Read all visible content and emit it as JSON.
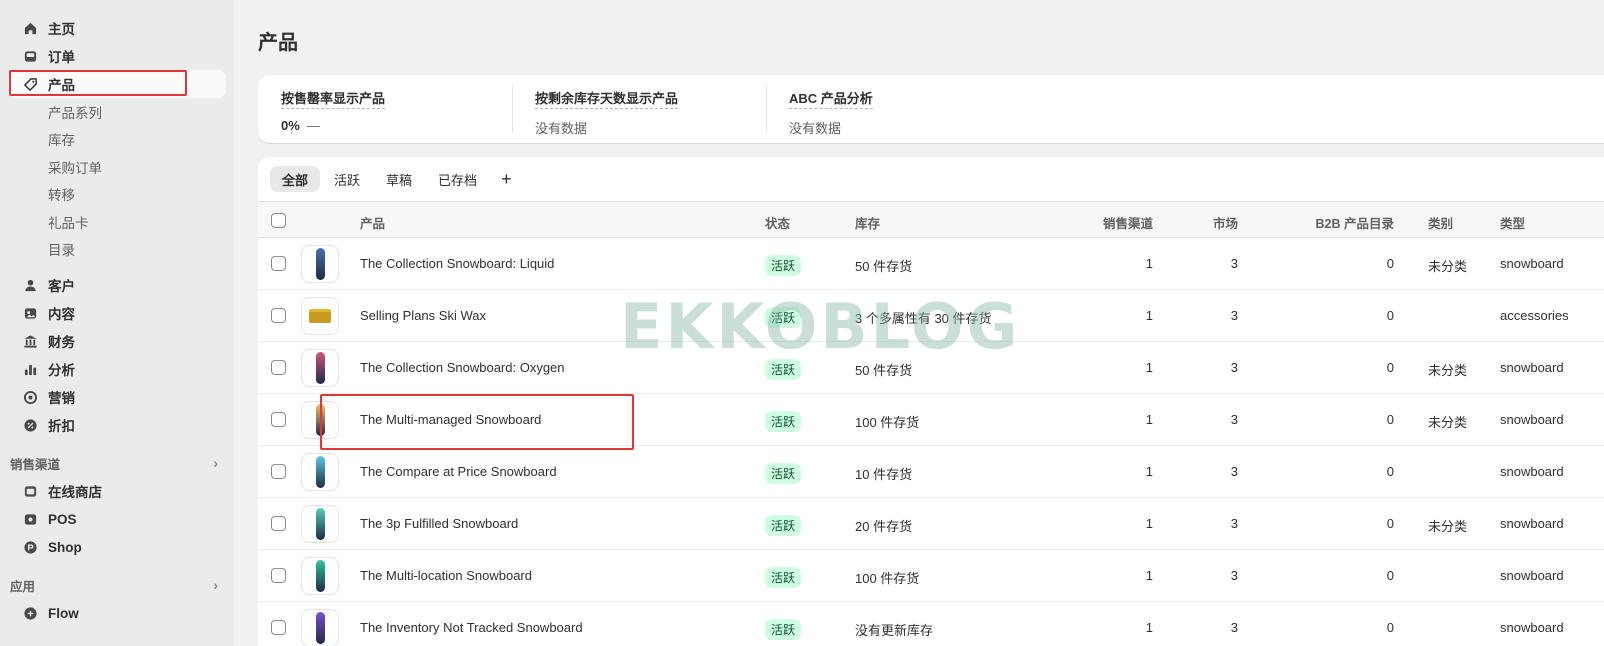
{
  "sidebar": {
    "items": [
      {
        "label": "主页",
        "icon": "home-icon"
      },
      {
        "label": "订单",
        "icon": "inbox-icon"
      },
      {
        "label": "产品",
        "icon": "tag-icon",
        "active": true
      }
    ],
    "product_sub": [
      "产品系列",
      "库存",
      "采购订单",
      "转移",
      "礼品卡",
      "目录"
    ],
    "items2": [
      {
        "label": "客户",
        "icon": "person-icon"
      },
      {
        "label": "内容",
        "icon": "content-icon"
      },
      {
        "label": "财务",
        "icon": "bank-icon"
      },
      {
        "label": "分析",
        "icon": "chart-icon"
      },
      {
        "label": "营销",
        "icon": "target-icon"
      },
      {
        "label": "折扣",
        "icon": "discount-icon"
      }
    ],
    "sales_channels_title": "销售渠道",
    "channels": [
      {
        "label": "在线商店",
        "icon": "store-icon"
      },
      {
        "label": "POS",
        "icon": "pos-icon"
      },
      {
        "label": "Shop",
        "icon": "shop-icon"
      }
    ],
    "apps_title": "应用",
    "apps": [
      {
        "label": "Flow",
        "icon": "flow-icon"
      }
    ]
  },
  "page": {
    "title": "产品"
  },
  "analytics": [
    {
      "title": "按售罄率显示产品",
      "value": "0%",
      "extra": "—"
    },
    {
      "title": "按剩余库存天数显示产品",
      "value": "没有数据",
      "extra": ""
    },
    {
      "title": "ABC 产品分析",
      "value": "没有数据",
      "extra": ""
    }
  ],
  "tabs": [
    "全部",
    "活跃",
    "草稿",
    "已存档"
  ],
  "tab_add": "+",
  "columns": {
    "product": "产品",
    "status": "状态",
    "inventory": "库存",
    "channels": "销售渠道",
    "markets": "市场",
    "b2b": "B2B 产品目录",
    "category": "类别",
    "type": "类型"
  },
  "rows": [
    {
      "name": "The Collection Snowboard: Liquid",
      "status": "活跃",
      "inventory": "50 件存货",
      "channels": "1",
      "markets": "3",
      "b2b": "0",
      "category": "未分类",
      "type": "snowboard",
      "thumb_color": "#4a6fa8"
    },
    {
      "name": "Selling Plans Ski Wax",
      "status": "活跃",
      "inventory": "3 个多属性有 30 件存货",
      "channels": "1",
      "markets": "3",
      "b2b": "0",
      "category": "",
      "type": "accessories",
      "thumb_color": "#c99a22"
    },
    {
      "name": "The Collection Snowboard: Oxygen",
      "status": "活跃",
      "inventory": "50 件存货",
      "channels": "1",
      "markets": "3",
      "b2b": "0",
      "category": "未分类",
      "type": "snowboard",
      "thumb_color": "#d0567a"
    },
    {
      "name": "The Multi-managed Snowboard",
      "status": "活跃",
      "inventory": "100 件存货",
      "channels": "1",
      "markets": "3",
      "b2b": "0",
      "category": "未分类",
      "type": "snowboard",
      "thumb_color": "#f2c26b"
    },
    {
      "name": "The Compare at Price Snowboard",
      "status": "活跃",
      "inventory": "10 件存货",
      "channels": "1",
      "markets": "3",
      "b2b": "0",
      "category": "",
      "type": "snowboard",
      "thumb_color": "#5cc8e0"
    },
    {
      "name": "The 3p Fulfilled Snowboard",
      "status": "活跃",
      "inventory": "20 件存货",
      "channels": "1",
      "markets": "3",
      "b2b": "0",
      "category": "未分类",
      "type": "snowboard",
      "thumb_color": "#4fd1b5"
    },
    {
      "name": "The Multi-location Snowboard",
      "status": "活跃",
      "inventory": "100 件存货",
      "channels": "1",
      "markets": "3",
      "b2b": "0",
      "category": "",
      "type": "snowboard",
      "thumb_color": "#2fc79a"
    },
    {
      "name": "The Inventory Not Tracked Snowboard",
      "status": "活跃",
      "inventory": "没有更新库存",
      "channels": "1",
      "markets": "3",
      "b2b": "0",
      "category": "",
      "type": "snowboard",
      "thumb_color": "#7a4fd1"
    }
  ],
  "watermark": "EKKOBLOG",
  "colors": {
    "highlight": "#e4363a",
    "badge_bg": "#cdfee1",
    "badge_text": "#0c5132"
  }
}
